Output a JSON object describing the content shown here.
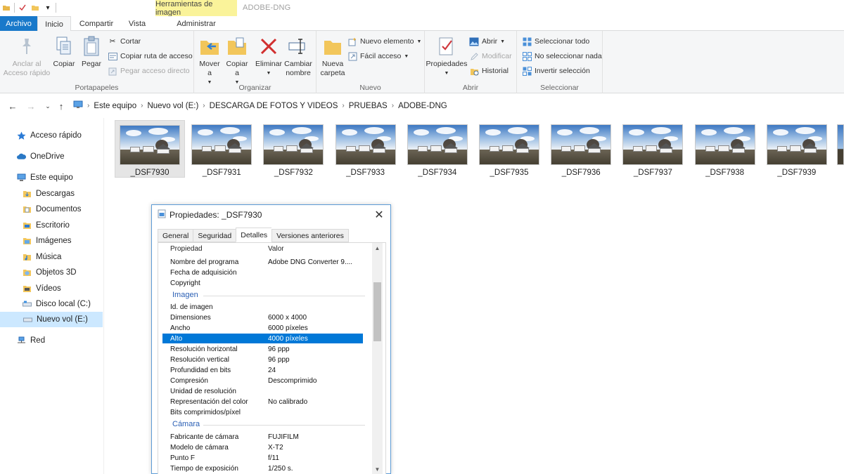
{
  "titlebar": {
    "context_group": "Herramientas de imagen",
    "window_title": "ADOBE-DNG"
  },
  "tabs": {
    "file": "Archivo",
    "home": "Inicio",
    "share": "Compartir",
    "view": "Vista",
    "manage": "Administrar"
  },
  "ribbon": {
    "clipboard": {
      "label": "Portapapeles",
      "pin": "Anclar al Acceso rápido",
      "copy": "Copiar",
      "paste": "Pegar",
      "cut": "Cortar",
      "copy_path": "Copiar ruta de acceso",
      "paste_shortcut": "Pegar acceso directo"
    },
    "organize": {
      "label": "Organizar",
      "move": "Mover a",
      "copy_to": "Copiar a",
      "delete": "Eliminar",
      "rename": "Cambiar nombre"
    },
    "new": {
      "label": "Nuevo",
      "new_folder": "Nueva carpeta",
      "new_item": "Nuevo elemento",
      "easy_access": "Fácil acceso"
    },
    "open": {
      "label": "Abrir",
      "properties": "Propiedades",
      "open": "Abrir",
      "edit": "Modificar",
      "history": "Historial"
    },
    "select": {
      "label": "Seleccionar",
      "select_all": "Seleccionar todo",
      "select_none": "No seleccionar nada",
      "invert": "Invertir selección"
    }
  },
  "address": {
    "crumbs": [
      "Este equipo",
      "Nuevo vol (E:)",
      "DESCARGA DE FOTOS Y VIDEOS",
      "PRUEBAS",
      "ADOBE-DNG"
    ]
  },
  "navpane": {
    "items": [
      {
        "label": "Acceso rápido",
        "icon": "star-icon"
      },
      {
        "label": "OneDrive",
        "icon": "cloud-icon"
      },
      {
        "label": "Este equipo",
        "icon": "computer-icon"
      },
      {
        "label": "Descargas",
        "icon": "download-folder-icon"
      },
      {
        "label": "Documentos",
        "icon": "documents-folder-icon"
      },
      {
        "label": "Escritorio",
        "icon": "desktop-folder-icon"
      },
      {
        "label": "Imágenes",
        "icon": "pictures-folder-icon"
      },
      {
        "label": "Música",
        "icon": "music-folder-icon"
      },
      {
        "label": "Objetos 3D",
        "icon": "3d-objects-icon"
      },
      {
        "label": "Vídeos",
        "icon": "videos-folder-icon"
      },
      {
        "label": "Disco local (C:)",
        "icon": "drive-icon"
      },
      {
        "label": "Nuevo vol (E:)",
        "icon": "drive-icon"
      },
      {
        "label": "Red",
        "icon": "network-icon"
      }
    ],
    "selected": "Nuevo vol (E:)"
  },
  "files": [
    "_DSF7930",
    "_DSF7931",
    "_DSF7932",
    "_DSF7933",
    "_DSF7934",
    "_DSF7935",
    "_DSF7936",
    "_DSF7937",
    "_DSF7938",
    "_DSF7939"
  ],
  "selected_file": "_DSF7930",
  "dialog": {
    "title": "Propiedades: _DSF7930",
    "tabs": [
      "General",
      "Seguridad",
      "Detalles",
      "Versiones anteriores"
    ],
    "active_tab": "Detalles",
    "header": {
      "property": "Propiedad",
      "value": "Valor"
    },
    "rows_top": [
      {
        "k": "Nombre del programa",
        "v": "Adobe DNG Converter 9...."
      },
      {
        "k": "Fecha de adquisición",
        "v": ""
      },
      {
        "k": "Copyright",
        "v": ""
      }
    ],
    "section_image": "Imagen",
    "rows_image": [
      {
        "k": "Id. de imagen",
        "v": ""
      },
      {
        "k": "Dimensiones",
        "v": "6000 x 4000"
      },
      {
        "k": "Ancho",
        "v": "6000 píxeles"
      },
      {
        "k": "Alto",
        "v": "4000 píxeles"
      },
      {
        "k": "Resolución horizontal",
        "v": "96 ppp"
      },
      {
        "k": "Resolución vertical",
        "v": "96 ppp"
      },
      {
        "k": "Profundidad en bits",
        "v": "24"
      },
      {
        "k": "Compresión",
        "v": "Descomprimido"
      },
      {
        "k": "Unidad de resolución",
        "v": ""
      },
      {
        "k": "Representación del color",
        "v": "No calibrado"
      },
      {
        "k": "Bits comprimidos/píxel",
        "v": ""
      }
    ],
    "selected_row": "Alto",
    "section_camera": "Cámara",
    "rows_camera": [
      {
        "k": "Fabricante de cámara",
        "v": "FUJIFILM"
      },
      {
        "k": "Modelo de cámara",
        "v": "X-T2"
      },
      {
        "k": "Punto F",
        "v": "f/11"
      },
      {
        "k": "Tiempo de exposición",
        "v": "1/250 s."
      }
    ]
  }
}
